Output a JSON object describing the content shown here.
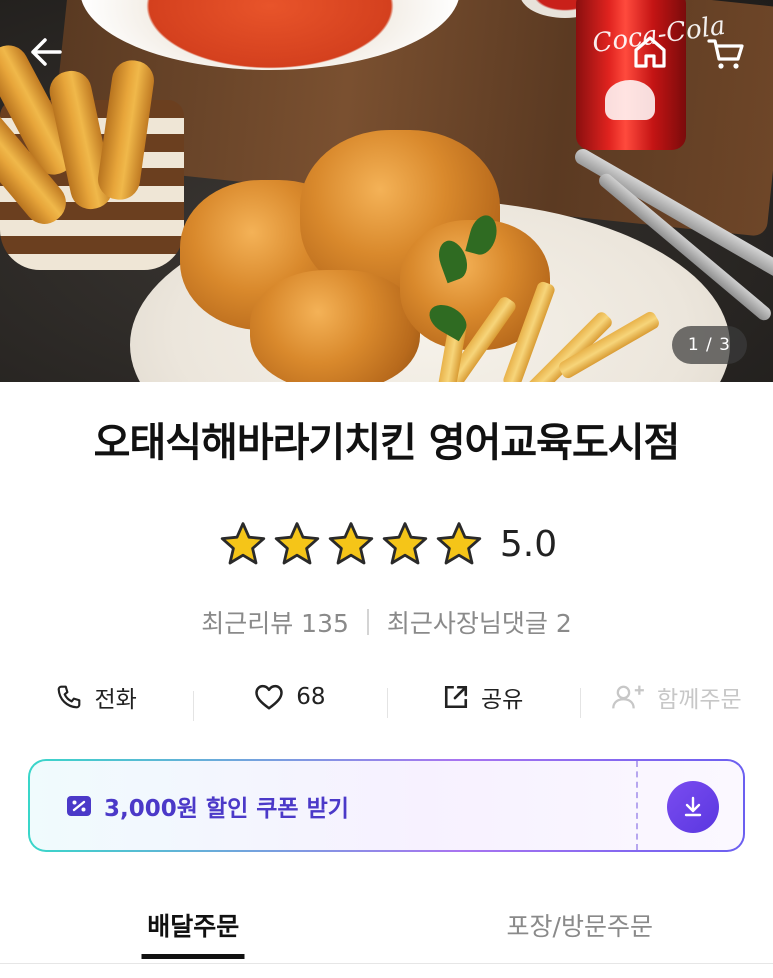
{
  "hero": {
    "pager_text": "1 / 3",
    "can_text": "Coca-Cola",
    "icons": {
      "back": "arrow-left-icon",
      "home": "home-icon",
      "cart": "cart-icon"
    }
  },
  "store": {
    "name": "오태식해바라기치킨 영어교육도시점",
    "rating_value": "5.0",
    "star_count": 5,
    "rating": 5.0,
    "star_color": "#f5c518",
    "recent_reviews": "최근리뷰 135",
    "owner_replies": "최근사장님댓글 2"
  },
  "actions": {
    "call_label": "전화",
    "like_count": "68",
    "share_label": "공유",
    "group_order_label": "함께주문"
  },
  "coupon": {
    "label": "3,000원 할인 쿠폰 받기",
    "accent_color": "#4b39c8"
  },
  "tabs": {
    "delivery": "배달주문",
    "pickup": "포장/방문주문"
  }
}
